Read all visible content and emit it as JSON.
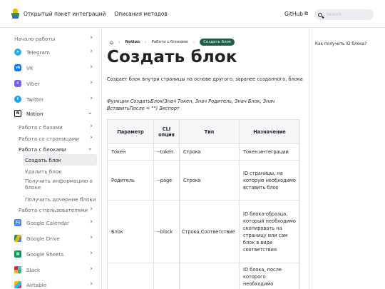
{
  "header": {
    "brand": "Открытый пакет интеграций",
    "methods_link": "Описания методов",
    "github_label": "GitHub",
    "search_placeholder": "Search"
  },
  "sidebar": {
    "items": [
      {
        "label": "Начало работы",
        "icon": "",
        "chevron": "›"
      },
      {
        "label": "Telegram",
        "icon": "telegram-icon",
        "chevron": "›",
        "color": "#2AABEE"
      },
      {
        "label": "VK",
        "icon": "vk-icon",
        "chevron": "›",
        "color": "#0077FF"
      },
      {
        "label": "Viber",
        "icon": "viber-icon",
        "chevron": "›",
        "color": "#7360F2"
      },
      {
        "label": "Twitter",
        "icon": "twitter-icon",
        "chevron": "›",
        "color": "#1DA1F2"
      },
      {
        "label": "Notion",
        "icon": "notion-icon",
        "chevron": "⌄",
        "color": "#000000"
      },
      {
        "label": "Работа с базами",
        "chevron": "›"
      },
      {
        "label": "Работа со страницами",
        "chevron": "›"
      },
      {
        "label": "Работа с блоками",
        "chevron": "⌄"
      },
      {
        "label": "Создать блок"
      },
      {
        "label": "Удалить блок"
      },
      {
        "label": "Получить информацию о блоке"
      },
      {
        "label": "Получить дочерние блоки"
      },
      {
        "label": "Работа с пользователями",
        "chevron": "›"
      },
      {
        "label": "Google Calendar",
        "icon": "google-calendar-icon",
        "chevron": "›"
      },
      {
        "label": "Google Drive",
        "icon": "google-drive-icon",
        "chevron": "›"
      },
      {
        "label": "Google Sheets",
        "icon": "google-sheets-icon",
        "chevron": "›"
      },
      {
        "label": "Slack",
        "icon": "slack-icon",
        "chevron": "›"
      },
      {
        "label": "Airtable",
        "icon": "airtable-icon",
        "chevron": "›"
      }
    ]
  },
  "breadcrumbs": {
    "home_icon": "home-icon",
    "items": [
      "Notion",
      "Работа с блоками",
      "Создать блок"
    ]
  },
  "page": {
    "title": "Создать блок",
    "description": "Создает блок внутри страницы на основе другого, заранее созданного, блока",
    "function_signature": "Функция СоздатьБлок(Знач Токен, Знач Родитель, Знач Блок, Знач ВставитьПосле = \"\") Экспорт"
  },
  "table": {
    "headers": [
      "Параметр",
      "CLI опция",
      "Тип",
      "Назначение"
    ],
    "rows": [
      [
        "Токен",
        "--token",
        "Строка",
        "Токен интеграции"
      ],
      [
        "Родитель",
        "--page",
        "Строка",
        "ID страницы, на которую необходимо вставить блок"
      ],
      [
        "Блок",
        "--block",
        "Строка,Соответствие",
        "ID блока-образца, который необходимо скопировать на страницу или сам блок в виде соответствия"
      ],
      [
        "",
        "",
        "",
        "ID блока, после которого необходимо"
      ]
    ]
  },
  "toc": {
    "link": "Как получить ID блока?"
  }
}
